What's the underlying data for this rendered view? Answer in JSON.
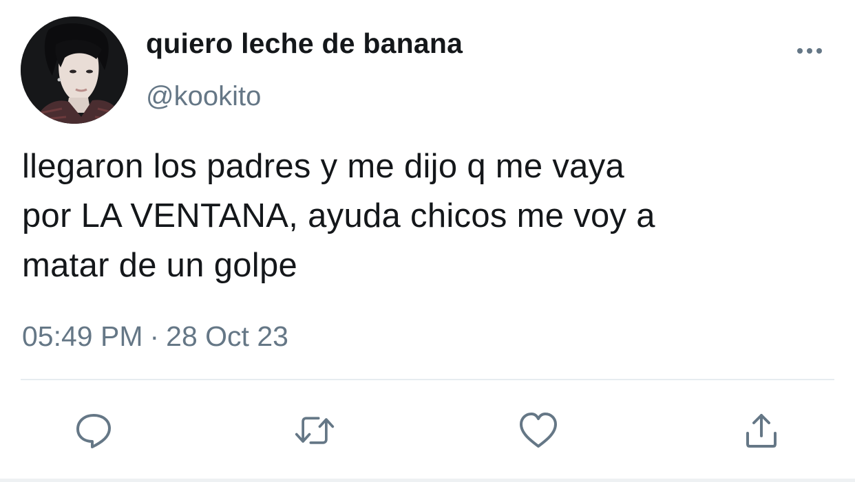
{
  "tweet": {
    "author": {
      "display_name": "quiero leche de banana",
      "handle": "@kookito",
      "avatar_icon": "profile-photo"
    },
    "text_lines": [
      "llegaron los padres y me dijo q me vaya",
      "por LA VENTANA, ayuda chicos me voy a",
      "matar de un golpe"
    ],
    "time": "05:49 PM",
    "separator": "·",
    "date": "28 Oct 23"
  },
  "actions": {
    "more_icon": "more-horizontal-icon",
    "reply_icon": "reply-icon",
    "retweet_icon": "retweet-icon",
    "like_icon": "like-icon",
    "share_icon": "share-icon"
  },
  "colors": {
    "text_primary": "#14171a",
    "text_secondary": "#657786",
    "divider": "#e6ecf0"
  }
}
